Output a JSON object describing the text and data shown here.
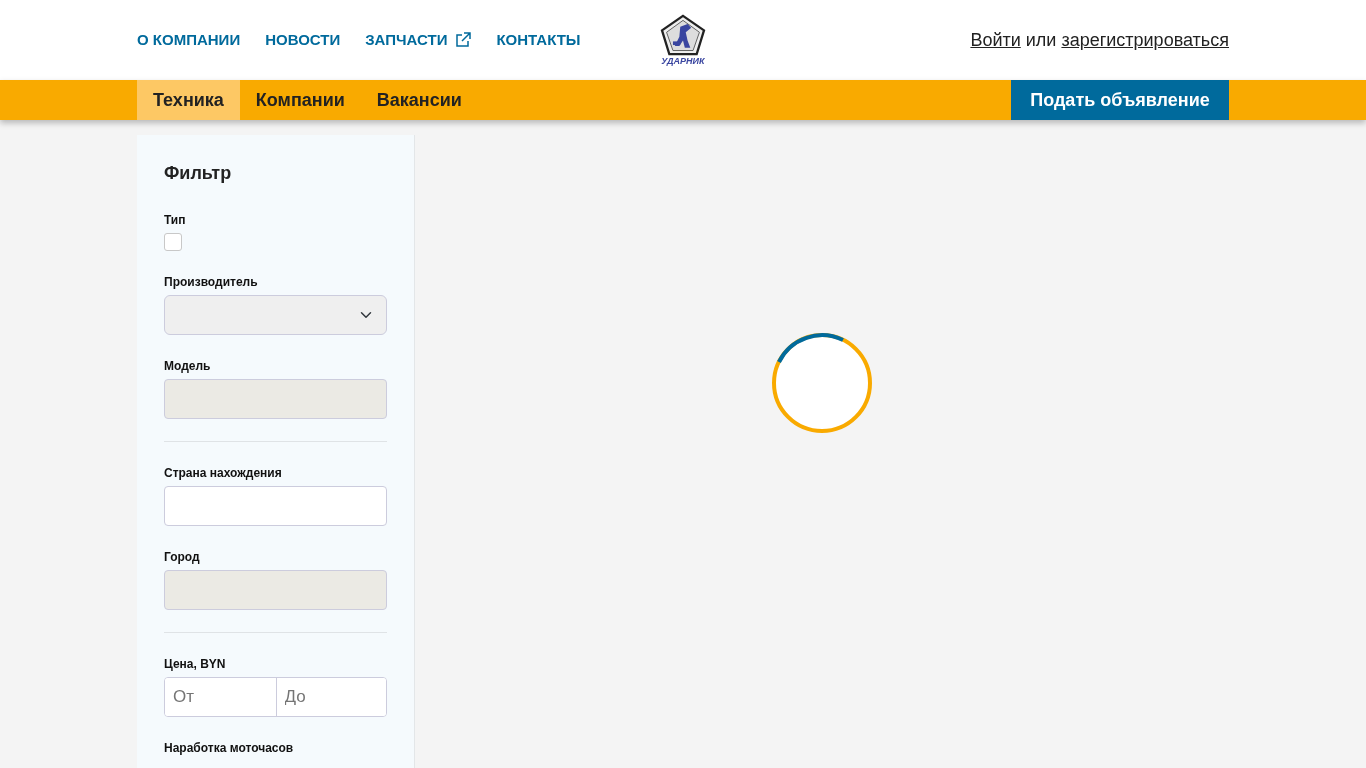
{
  "top_nav": [
    {
      "label": "О КОМПАНИИ",
      "external": false
    },
    {
      "label": "НОВОСТИ",
      "external": false
    },
    {
      "label": "ЗАПЧАСТИ",
      "external": true
    },
    {
      "label": "КОНТАКТЫ",
      "external": false
    }
  ],
  "logo": {
    "text": "УДАРНИК"
  },
  "auth": {
    "login": "Войти",
    "separator": "или",
    "register": "зарегистрироваться"
  },
  "tabs": [
    {
      "label": "Техника",
      "selected": true
    },
    {
      "label": "Компании",
      "selected": false
    },
    {
      "label": "Вакансии",
      "selected": false
    }
  ],
  "post_button": "Подать объявление",
  "filter": {
    "title": "Фильтр",
    "fields": [
      {
        "kind": "checkbox",
        "label": "Тип",
        "checked": false
      },
      {
        "kind": "select",
        "label": "Производитель"
      },
      {
        "kind": "input",
        "label": "Модель",
        "disabled": true
      },
      {
        "kind": "divider"
      },
      {
        "kind": "input",
        "label": "Страна нахождения",
        "disabled": false
      },
      {
        "kind": "input",
        "label": "Город",
        "disabled": true
      },
      {
        "kind": "divider"
      },
      {
        "kind": "range",
        "label": "Цена, BYN",
        "from_placeholder": "От",
        "to_placeholder": "До"
      },
      {
        "kind": "heading",
        "label": "Наработка моточасов"
      }
    ]
  },
  "loading": true
}
